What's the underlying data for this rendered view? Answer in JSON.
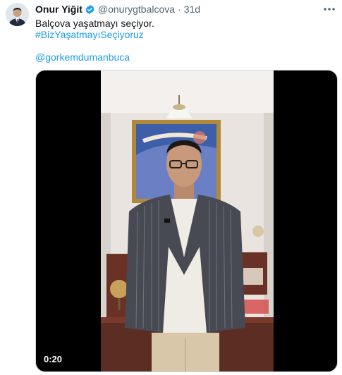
{
  "tweet": {
    "author_name": "Onur Yiğit",
    "author_handle": "@onurygtbalcova",
    "separator": "·",
    "timestamp": "31d",
    "text_line1": "Balçova yaşatmayı seçiyor.",
    "hashtag": "#BizYaşatmayıSeçiyoruz",
    "mention": "@gorkemdumanbuca"
  },
  "media": {
    "duration": "0:20"
  },
  "colors": {
    "link": "#1d9bf0",
    "verified": "#1d9bf0",
    "secondary_text": "#536471"
  },
  "icons": {
    "verified": "verified-badge-icon",
    "more": "more-options-icon"
  }
}
